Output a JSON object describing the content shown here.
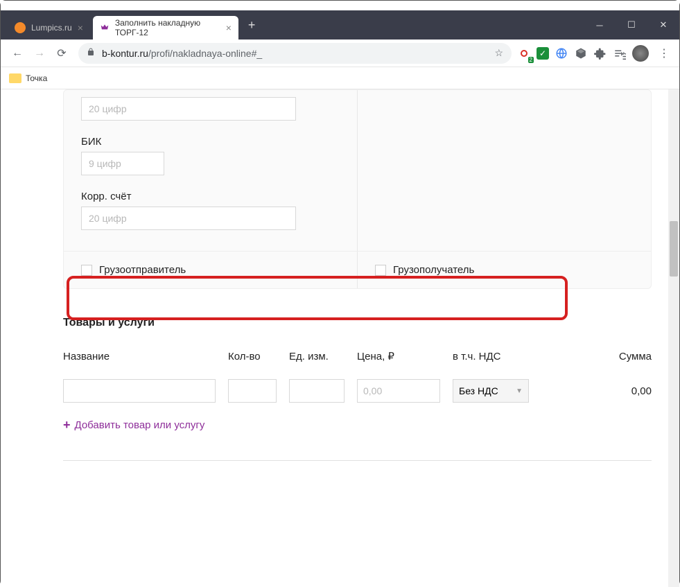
{
  "browser": {
    "tabs": [
      {
        "title": "Lumpics.ru",
        "active": false
      },
      {
        "title": "Заполнить накладную ТОРГ-12",
        "active": true
      }
    ],
    "url_host": "b-kontur.ru",
    "url_path": "/profi/nakladnaya-online#_",
    "bookmarks": [
      {
        "label": "Точка"
      }
    ],
    "extensions": {
      "badge_count": "2"
    }
  },
  "form": {
    "fields": {
      "account": {
        "placeholder": "20 цифр"
      },
      "bik": {
        "label": "БИК",
        "placeholder": "9 цифр"
      },
      "corr": {
        "label": "Корр. счёт",
        "placeholder": "20 цифр"
      }
    },
    "checks": {
      "sender": "Грузоотправитель",
      "receiver": "Грузополучатель"
    }
  },
  "goods": {
    "title": "Товары и услуги",
    "headers": {
      "name": "Название",
      "qty": "Кол-во",
      "unit": "Ед. изм.",
      "price": "Цена, ₽",
      "vat": "в т.ч. НДС",
      "sum": "Сумма"
    },
    "row": {
      "price_placeholder": "0,00",
      "vat_value": "Без НДС",
      "sum_value": "0,00"
    },
    "add_label": "Добавить товар или услугу"
  }
}
